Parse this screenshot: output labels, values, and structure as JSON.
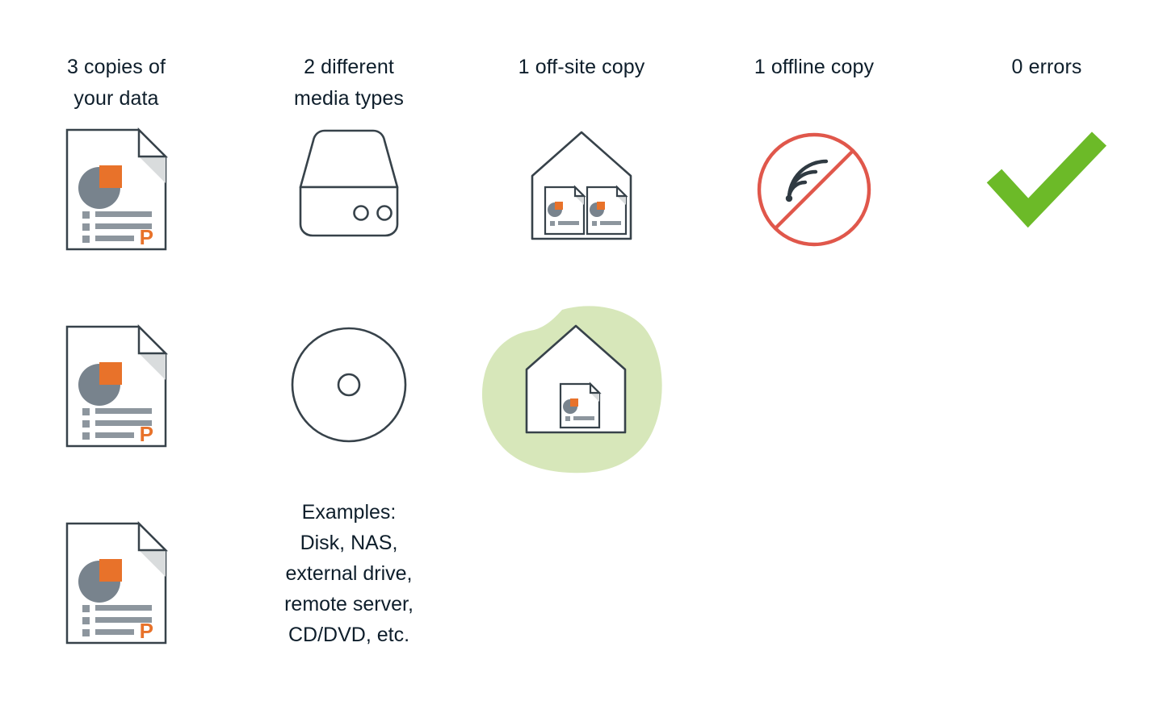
{
  "diagram": {
    "title": "3-2-1-1-0 backup rule",
    "background_color": "#ffffff",
    "text_color": "#0e1e2b"
  },
  "palette": {
    "ink": "#37424a",
    "ink_dark": "#2f3a42",
    "orange": "#e8722a",
    "gray": "#78838d",
    "gray_light": "#8d969e",
    "fold_shadow": "#d9dcdd",
    "red": "#e0574b",
    "green_check": "#6cba28",
    "green_blob": "#d7e7ba"
  },
  "columns": [
    {
      "id": "copies",
      "heading": "3 copies of\nyour data",
      "icons": [
        {
          "name": "document-icon",
          "label": "document with pie chart",
          "row": 1
        },
        {
          "name": "document-icon",
          "label": "document with pie chart",
          "row": 2
        },
        {
          "name": "document-icon",
          "label": "document with pie chart",
          "row": 3
        }
      ],
      "caption": ""
    },
    {
      "id": "media-types",
      "heading": "2 different\nmedia types",
      "icons": [
        {
          "name": "hard-drive-icon",
          "label": "NAS / external drive",
          "row": 1
        },
        {
          "name": "cd-disc-icon",
          "label": "CD or DVD disc",
          "row": 2
        }
      ],
      "caption": "Examples:\nDisk, NAS,\nexternal drive,\nremote server,\nCD/DVD, etc."
    },
    {
      "id": "off-site",
      "heading": "1 off-site copy",
      "icons": [
        {
          "name": "house-two-documents-icon",
          "label": "house containing two documents",
          "row": 1
        },
        {
          "name": "house-one-document-highlighted-icon",
          "label": "highlighted off-site house with one document",
          "row": 2
        }
      ],
      "caption": ""
    },
    {
      "id": "offline",
      "heading": "1 offline copy",
      "icons": [
        {
          "name": "no-wifi-icon",
          "label": "wifi signal crossed out in red",
          "row": 1
        }
      ],
      "caption": ""
    },
    {
      "id": "errors",
      "heading": "0 errors",
      "icons": [
        {
          "name": "green-checkmark-icon",
          "label": "green check mark",
          "row": 1
        }
      ],
      "caption": ""
    }
  ]
}
